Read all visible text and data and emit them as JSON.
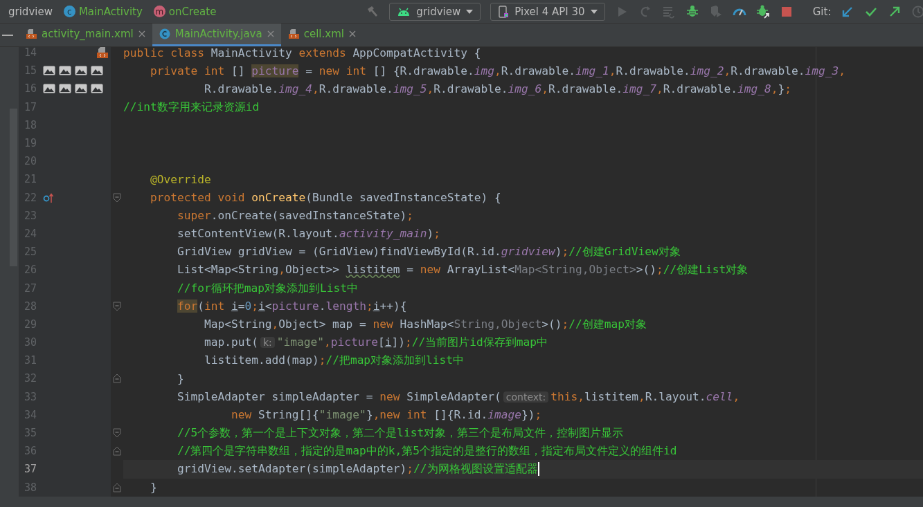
{
  "breadcrumb": [
    {
      "kind": "module",
      "label": "gridview"
    },
    {
      "kind": "class",
      "icon_letter": "c",
      "label": "MainActivity"
    },
    {
      "kind": "method",
      "icon_letter": "m",
      "label": "onCreate"
    }
  ],
  "run_config": {
    "label": "gridview"
  },
  "device": {
    "label": "Pixel 4 API 30"
  },
  "git_label": "Git:",
  "tabs": [
    {
      "kind": "xml",
      "label": "activity_main.xml",
      "selected": false
    },
    {
      "kind": "class",
      "label": "MainActivity.java",
      "selected": true
    },
    {
      "kind": "xml",
      "label": "cell.xml",
      "selected": false
    }
  ],
  "lines": [
    {
      "number": "14",
      "gutter_icons": [
        {
          "kind": "layout"
        }
      ],
      "current": false,
      "tokens": [
        {
          "kind": "kw",
          "text": "public class "
        },
        {
          "kind": "plain",
          "text": "MainActivity "
        },
        {
          "kind": "kw",
          "text": "extends "
        },
        {
          "kind": "plain",
          "text": "AppCompatActivity {"
        }
      ]
    },
    {
      "number": "15",
      "gutter_icons": [
        {
          "kind": "image"
        },
        {
          "kind": "image"
        },
        {
          "kind": "image"
        },
        {
          "kind": "image"
        }
      ],
      "current": false,
      "tokens": [
        {
          "kind": "kw",
          "text": "    private int "
        },
        {
          "kind": "plain",
          "text": "[] "
        },
        {
          "kind": "field_match",
          "text": "picture"
        },
        {
          "kind": "plain",
          "text": " = "
        },
        {
          "kind": "kw",
          "text": "new int "
        },
        {
          "kind": "plain",
          "text": "[] {R.drawable."
        },
        {
          "kind": "static",
          "text": "img"
        },
        {
          "kind": "kw",
          "text": ","
        },
        {
          "kind": "plain",
          "text": "R.drawable."
        },
        {
          "kind": "static",
          "text": "img_1"
        },
        {
          "kind": "kw",
          "text": ","
        },
        {
          "kind": "plain",
          "text": "R.drawable."
        },
        {
          "kind": "static",
          "text": "img_2"
        },
        {
          "kind": "kw",
          "text": ","
        },
        {
          "kind": "plain",
          "text": "R.drawable."
        },
        {
          "kind": "static",
          "text": "img_3"
        },
        {
          "kind": "kw",
          "text": ","
        }
      ]
    },
    {
      "number": "16",
      "gutter_icons": [
        {
          "kind": "image"
        },
        {
          "kind": "image"
        },
        {
          "kind": "image"
        },
        {
          "kind": "image"
        }
      ],
      "current": false,
      "tokens": [
        {
          "kind": "plain",
          "text": "            R.drawable."
        },
        {
          "kind": "static",
          "text": "img_4"
        },
        {
          "kind": "kw",
          "text": ","
        },
        {
          "kind": "plain",
          "text": "R.drawable."
        },
        {
          "kind": "static",
          "text": "img_5"
        },
        {
          "kind": "kw",
          "text": ","
        },
        {
          "kind": "plain",
          "text": "R.drawable."
        },
        {
          "kind": "static",
          "text": "img_6"
        },
        {
          "kind": "kw",
          "text": ","
        },
        {
          "kind": "plain",
          "text": "R.drawable."
        },
        {
          "kind": "static",
          "text": "img_7"
        },
        {
          "kind": "kw",
          "text": ","
        },
        {
          "kind": "plain",
          "text": "R.drawable."
        },
        {
          "kind": "static",
          "text": "img_8"
        },
        {
          "kind": "kw",
          "text": ","
        },
        {
          "kind": "plain",
          "text": "}"
        },
        {
          "kind": "kw",
          "text": ";"
        }
      ]
    },
    {
      "number": "17",
      "current": false,
      "tokens": [
        {
          "kind": "comment",
          "text": "//int数字用来记录资源id"
        }
      ]
    },
    {
      "number": "18",
      "current": false
    },
    {
      "number": "19",
      "current": false
    },
    {
      "number": "20",
      "current": false
    },
    {
      "number": "21",
      "current": false,
      "tokens": [
        {
          "kind": "annotation",
          "text": "    @Override"
        }
      ]
    },
    {
      "number": "22",
      "gutter_icons": [
        {
          "kind": "override"
        }
      ],
      "fold_marker": {
        "kind": "start"
      },
      "current": false,
      "tokens": [
        {
          "kind": "kw",
          "text": "    protected void "
        },
        {
          "kind": "method",
          "text": "onCreate"
        },
        {
          "kind": "plain",
          "text": "(Bundle savedInstanceState) {"
        }
      ]
    },
    {
      "number": "23",
      "current": false,
      "tokens": [
        {
          "kind": "kw",
          "text": "        super"
        },
        {
          "kind": "plain",
          "text": ".onCreate(savedInstanceState)"
        },
        {
          "kind": "kw",
          "text": ";"
        }
      ]
    },
    {
      "number": "24",
      "current": false,
      "tokens": [
        {
          "kind": "plain",
          "text": "        setContentView(R.layout."
        },
        {
          "kind": "static",
          "text": "activity_main"
        },
        {
          "kind": "plain",
          "text": ")"
        },
        {
          "kind": "kw",
          "text": ";"
        }
      ]
    },
    {
      "number": "25",
      "current": false,
      "tokens": [
        {
          "kind": "plain",
          "text": "        GridView gridView = (GridView)findViewById(R.id."
        },
        {
          "kind": "static",
          "text": "gridview"
        },
        {
          "kind": "plain",
          "text": ")"
        },
        {
          "kind": "kw",
          "text": ";"
        },
        {
          "kind": "comment",
          "text": "//创建GridView对象"
        }
      ]
    },
    {
      "number": "26",
      "current": false,
      "tokens": [
        {
          "kind": "plain",
          "text": "        List<Map<String"
        },
        {
          "kind": "kw",
          "text": ","
        },
        {
          "kind": "plain",
          "text": "Object>> "
        },
        {
          "kind": "warning",
          "text": "listitem"
        },
        {
          "kind": "plain",
          "text": " = "
        },
        {
          "kind": "kw",
          "text": "new "
        },
        {
          "kind": "plain",
          "text": "ArrayList<"
        },
        {
          "kind": "generic",
          "text": "Map<String,Object>"
        },
        {
          "kind": "plain",
          "text": ">()"
        },
        {
          "kind": "kw",
          "text": ";"
        },
        {
          "kind": "comment",
          "text": "//创建List对象"
        }
      ]
    },
    {
      "number": "27",
      "current": false,
      "tokens": [
        {
          "kind": "comment",
          "text": "        //for循环把map对象添加到List中"
        }
      ]
    },
    {
      "number": "28",
      "fold_marker": {
        "kind": "start"
      },
      "current": false,
      "tokens": [
        {
          "kind": "kw_match",
          "text": "        for"
        },
        {
          "kind": "plain",
          "text": "("
        },
        {
          "kind": "kw",
          "text": "int "
        },
        {
          "kind": "var",
          "text": "i"
        },
        {
          "kind": "plain",
          "text": "="
        },
        {
          "kind": "number",
          "text": "0"
        },
        {
          "kind": "kw",
          "text": ";"
        },
        {
          "kind": "var",
          "text": "i"
        },
        {
          "kind": "plain",
          "text": "<"
        },
        {
          "kind": "field",
          "text": "picture"
        },
        {
          "kind": "plain",
          "text": "."
        },
        {
          "kind": "field",
          "text": "length"
        },
        {
          "kind": "kw",
          "text": ";"
        },
        {
          "kind": "var",
          "text": "i"
        },
        {
          "kind": "plain",
          "text": "++){"
        }
      ]
    },
    {
      "number": "29",
      "current": false,
      "tokens": [
        {
          "kind": "plain",
          "text": "            Map<String"
        },
        {
          "kind": "kw",
          "text": ","
        },
        {
          "kind": "plain",
          "text": "Object> map = "
        },
        {
          "kind": "kw",
          "text": "new "
        },
        {
          "kind": "plain",
          "text": "HashMap<"
        },
        {
          "kind": "generic",
          "text": "String,Object"
        },
        {
          "kind": "plain",
          "text": ">()"
        },
        {
          "kind": "kw",
          "text": ";"
        },
        {
          "kind": "comment",
          "text": "//创建map对象"
        }
      ]
    },
    {
      "number": "30",
      "current": false,
      "tokens": [
        {
          "kind": "plain",
          "text": "            map.put("
        },
        {
          "kind": "hint",
          "text": "k:"
        },
        {
          "kind": "string",
          "text": "\"image\""
        },
        {
          "kind": "kw",
          "text": ","
        },
        {
          "kind": "field",
          "text": "picture"
        },
        {
          "kind": "plain",
          "text": "["
        },
        {
          "kind": "var",
          "text": "i"
        },
        {
          "kind": "plain",
          "text": "])"
        },
        {
          "kind": "kw",
          "text": ";"
        },
        {
          "kind": "comment",
          "text": "//当前图片id保存到map中"
        }
      ]
    },
    {
      "number": "31",
      "current": false,
      "tokens": [
        {
          "kind": "plain",
          "text": "            listitem.add(map)"
        },
        {
          "kind": "kw",
          "text": ";"
        },
        {
          "kind": "comment",
          "text": "//把map对象添加到list中"
        }
      ]
    },
    {
      "number": "32",
      "fold_marker": {
        "kind": "end"
      },
      "current": false,
      "tokens": [
        {
          "kind": "plain",
          "text": "        }"
        }
      ]
    },
    {
      "number": "33",
      "current": false,
      "tokens": [
        {
          "kind": "plain",
          "text": "        SimpleAdapter simpleAdapter = "
        },
        {
          "kind": "kw",
          "text": "new "
        },
        {
          "kind": "plain",
          "text": "SimpleAdapter("
        },
        {
          "kind": "hint",
          "text": "context:"
        },
        {
          "kind": "kw",
          "text": "this,"
        },
        {
          "kind": "plain",
          "text": "listitem"
        },
        {
          "kind": "kw",
          "text": ","
        },
        {
          "kind": "plain",
          "text": "R.layout."
        },
        {
          "kind": "static",
          "text": "cell"
        },
        {
          "kind": "kw",
          "text": ","
        }
      ]
    },
    {
      "number": "34",
      "current": false,
      "tokens": [
        {
          "kind": "kw",
          "text": "                new "
        },
        {
          "kind": "plain",
          "text": "String[]{"
        },
        {
          "kind": "string",
          "text": "\"image\""
        },
        {
          "kind": "plain",
          "text": "}"
        },
        {
          "kind": "kw",
          "text": ",new int "
        },
        {
          "kind": "plain",
          "text": "[]{R.id."
        },
        {
          "kind": "static",
          "text": "image"
        },
        {
          "kind": "plain",
          "text": "})"
        },
        {
          "kind": "kw",
          "text": ";"
        }
      ]
    },
    {
      "number": "35",
      "fold_marker": {
        "kind": "start"
      },
      "current": false,
      "tokens": [
        {
          "kind": "comment",
          "text": "        //5个参数，第一个是上下文对象，第二个是list对象，第三个是布局文件，控制图片显示"
        }
      ]
    },
    {
      "number": "36",
      "fold_marker": {
        "kind": "end"
      },
      "current": false,
      "tokens": [
        {
          "kind": "comment",
          "text": "        //第四个是字符串数组，指定的是map中的k,第5个指定的是整行的数组，指定布局文件定义的组件id"
        }
      ]
    },
    {
      "number": "37",
      "current": true,
      "tokens": [
        {
          "kind": "plain",
          "text": "        gridView.setAdapter(simpleAdapter)"
        },
        {
          "kind": "kw",
          "text": ";"
        },
        {
          "kind": "comment",
          "text": "//为网格视图设置适配器"
        }
      ]
    },
    {
      "number": "38",
      "fold_marker": {
        "kind": "end"
      },
      "current": false,
      "tokens": [
        {
          "kind": "plain",
          "text": "    }"
        }
      ]
    }
  ]
}
